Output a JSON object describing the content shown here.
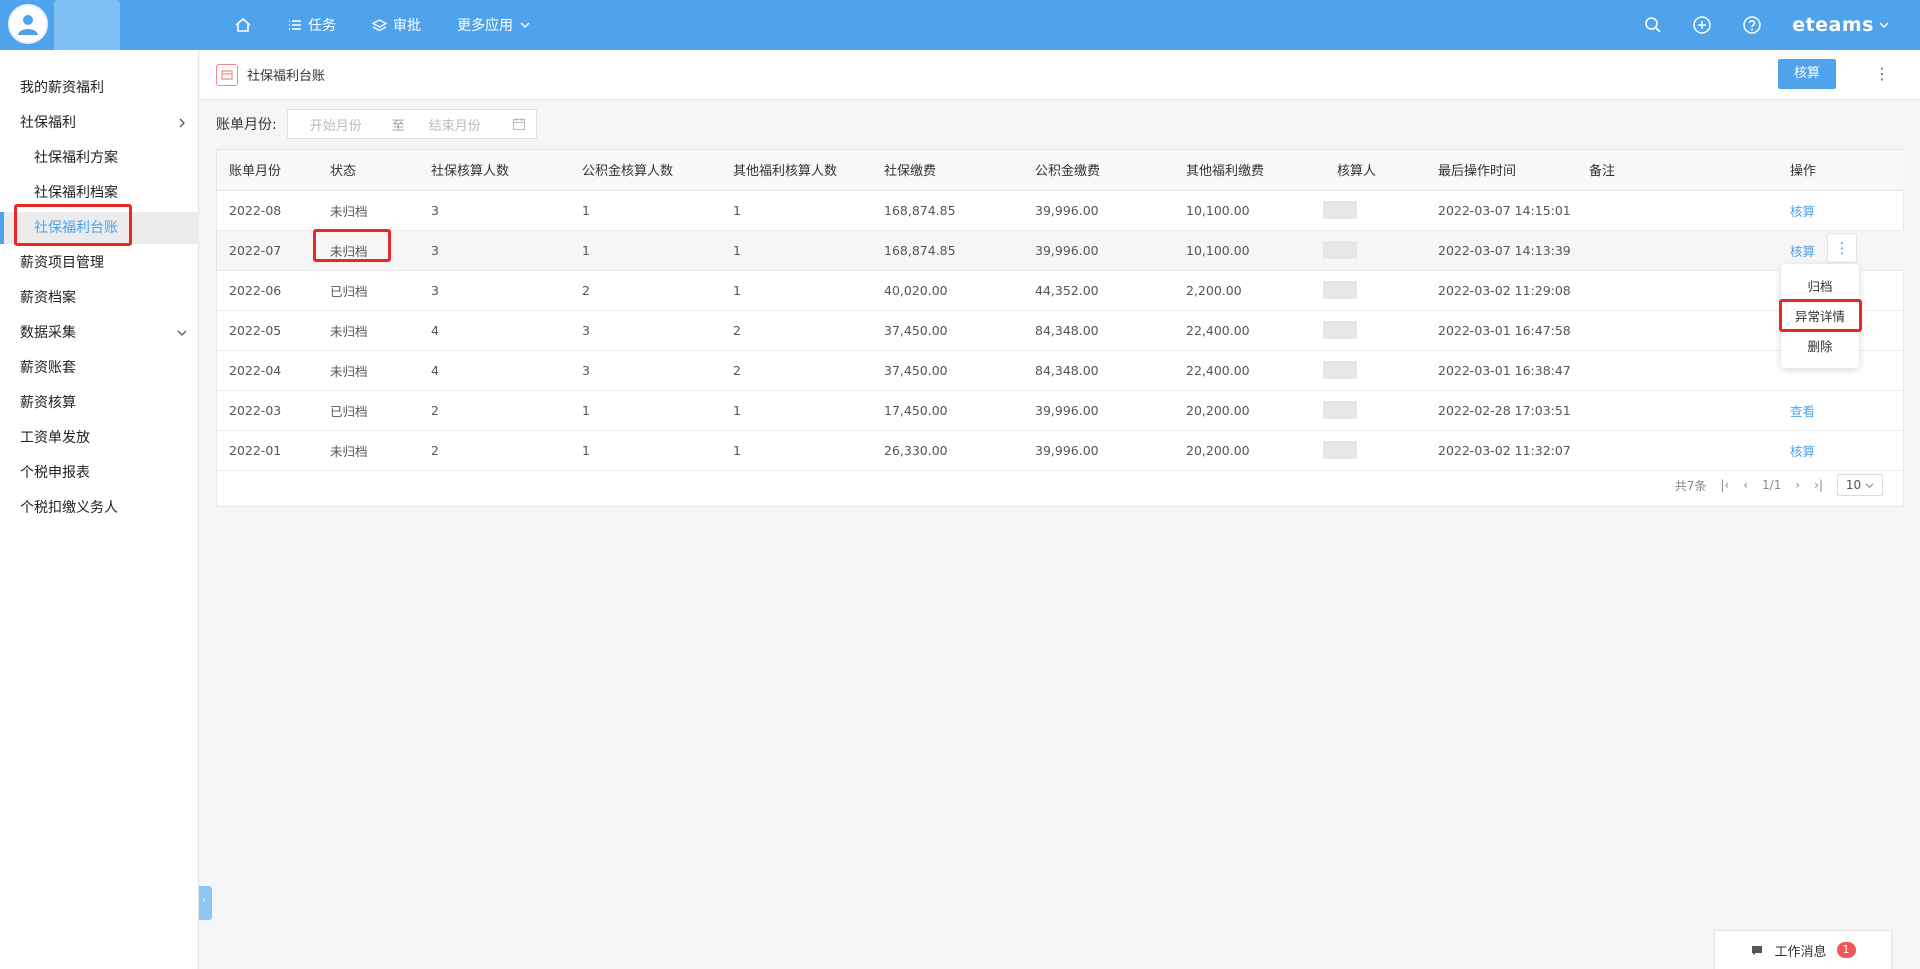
{
  "topbar": {
    "nav": [
      {
        "icon": "home-icon",
        "label": ""
      },
      {
        "icon": "list-icon",
        "label": "任务"
      },
      {
        "icon": "layers-icon",
        "label": "审批"
      },
      {
        "icon": "chevron-down-icon",
        "label": "更多应用"
      }
    ],
    "brand": "eteams",
    "accent": "#4ea3ec"
  },
  "sidebar": {
    "items": [
      {
        "label": "我的薪资福利"
      },
      {
        "label": "社保福利"
      },
      {
        "label": "社保福利方案"
      },
      {
        "label": "社保福利档案"
      },
      {
        "label": "社保福利台账"
      },
      {
        "label": "薪资项目管理"
      },
      {
        "label": "薪资档案"
      },
      {
        "label": "数据采集"
      },
      {
        "label": "薪资账套"
      },
      {
        "label": "薪资核算"
      },
      {
        "label": "工资单发放"
      },
      {
        "label": "个税申报表"
      },
      {
        "label": "个税扣缴义务人"
      }
    ]
  },
  "page": {
    "title": "社保福利台账",
    "calc_button": "核算"
  },
  "filter": {
    "label": "账单月份:",
    "start_placeholder": "开始月份",
    "to": "至",
    "end_placeholder": "结束月份"
  },
  "table": {
    "columns": [
      "账单月份",
      "状态",
      "社保核算人数",
      "公积金核算人数",
      "其他福利核算人数",
      "社保缴费",
      "公积金缴费",
      "其他福利缴费",
      "核算人",
      "最后操作时间",
      "备注",
      "操作"
    ],
    "rows": [
      {
        "month": "2022-08",
        "status": "未归档",
        "ss": "3",
        "hf": "1",
        "other": "1",
        "ss_fee": "168,874.85",
        "hf_fee": "39,996.00",
        "other_fee": "10,100.00",
        "time": "2022-03-07 14:15:01",
        "op": "核算"
      },
      {
        "month": "2022-07",
        "status": "未归档",
        "ss": "3",
        "hf": "1",
        "other": "1",
        "ss_fee": "168,874.85",
        "hf_fee": "39,996.00",
        "other_fee": "10,100.00",
        "time": "2022-03-07 14:13:39",
        "op": "核算"
      },
      {
        "month": "2022-06",
        "status": "已归档",
        "ss": "3",
        "hf": "2",
        "other": "1",
        "ss_fee": "40,020.00",
        "hf_fee": "44,352.00",
        "other_fee": "2,200.00",
        "time": "2022-03-02 11:29:08",
        "op": ""
      },
      {
        "month": "2022-05",
        "status": "未归档",
        "ss": "4",
        "hf": "3",
        "other": "2",
        "ss_fee": "37,450.00",
        "hf_fee": "84,348.00",
        "other_fee": "22,400.00",
        "time": "2022-03-01 16:47:58",
        "op": ""
      },
      {
        "month": "2022-04",
        "status": "未归档",
        "ss": "4",
        "hf": "3",
        "other": "2",
        "ss_fee": "37,450.00",
        "hf_fee": "84,348.00",
        "other_fee": "22,400.00",
        "time": "2022-03-01 16:38:47",
        "op": ""
      },
      {
        "month": "2022-03",
        "status": "已归档",
        "ss": "2",
        "hf": "1",
        "other": "1",
        "ss_fee": "17,450.00",
        "hf_fee": "39,996.00",
        "other_fee": "20,200.00",
        "time": "2022-02-28 17:03:51",
        "op": "查看"
      },
      {
        "month": "2022-01",
        "status": "未归档",
        "ss": "2",
        "hf": "1",
        "other": "1",
        "ss_fee": "26,330.00",
        "hf_fee": "39,996.00",
        "other_fee": "20,200.00",
        "time": "2022-03-02 11:32:07",
        "op": "核算"
      }
    ]
  },
  "row_menu": {
    "items": [
      "归档",
      "异常详情",
      "删除"
    ]
  },
  "pager": {
    "total": "共7条",
    "page": "1/1",
    "size": "10"
  },
  "workmsg": {
    "label": "工作消息",
    "count": "1"
  }
}
